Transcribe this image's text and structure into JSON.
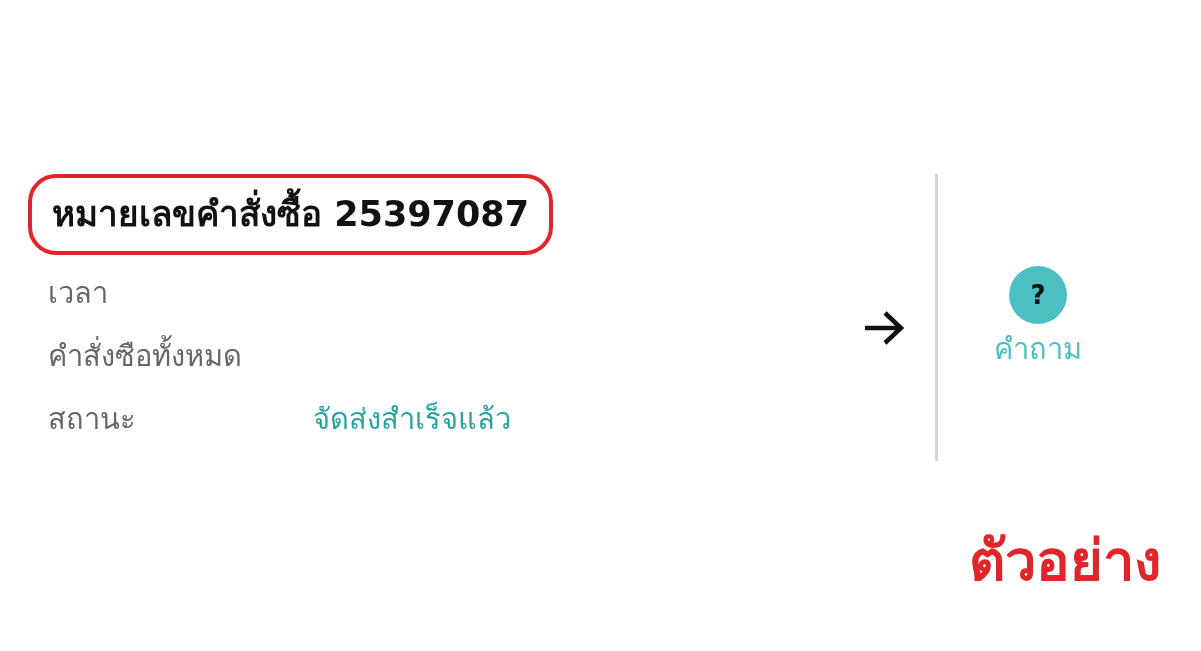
{
  "order": {
    "title": "หมายเลขคำสั่งซื้อ 25397087",
    "highlighted": true,
    "fields": [
      {
        "label": "เวลา"
      },
      {
        "label": "คำสั่งซือทั้งหมด"
      },
      {
        "label": "สถานะ",
        "value": "จัดส่งสำเร็จแล้ว"
      }
    ]
  },
  "help": {
    "icon_text": "?",
    "label": "คำถาม"
  },
  "annotation": "ตัวอย่าง"
}
